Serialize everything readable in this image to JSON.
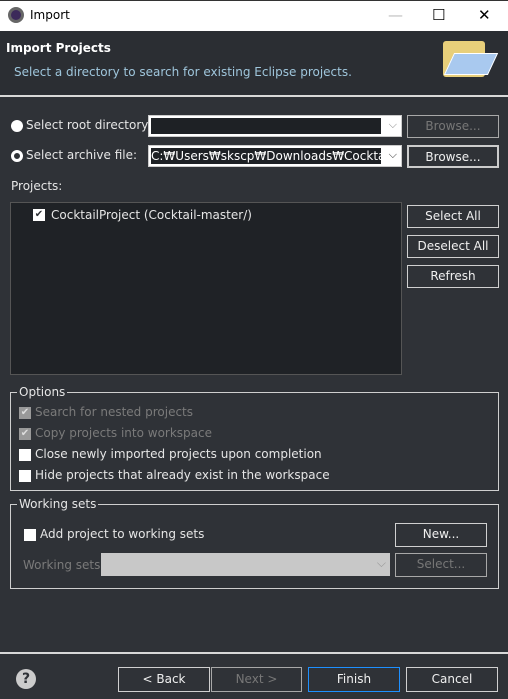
{
  "window": {
    "title": "Import",
    "minimize": "—",
    "maximize": "☐",
    "close": "✕"
  },
  "header": {
    "title": "Import Projects",
    "description": "Select a directory to search for existing Eclipse projects."
  },
  "source": {
    "root_label": "Select root directory:",
    "root_value": "",
    "root_browse": "Browse...",
    "archive_label": "Select archive file:",
    "archive_value": "C:₩Users₩skscp₩Downloads₩Cocktail-master.zip",
    "archive_browse": "Browse...",
    "selected": "archive"
  },
  "projects": {
    "label": "Projects:",
    "items": [
      {
        "label": "CocktailProject (Cocktail-master/)",
        "checked": true
      }
    ],
    "select_all": "Select All",
    "deselect_all": "Deselect All",
    "refresh": "Refresh"
  },
  "options": {
    "legend": "Options",
    "items": [
      {
        "label": "Search for nested projects",
        "checked": true,
        "enabled": false
      },
      {
        "label": "Copy projects into workspace",
        "checked": true,
        "enabled": false
      },
      {
        "label": "Close newly imported projects upon completion",
        "checked": false,
        "enabled": true
      },
      {
        "label": "Hide projects that already exist in the workspace",
        "checked": false,
        "enabled": true
      }
    ]
  },
  "working_sets": {
    "legend": "Working sets",
    "add_label": "Add project to working sets",
    "new": "New...",
    "sets_label": "Working sets:",
    "select": "Select..."
  },
  "footer": {
    "help": "?",
    "back": "< Back",
    "next": "Next >",
    "finish": "Finish",
    "cancel": "Cancel"
  },
  "colors": {
    "background": "#2f3237",
    "accent": "#1e90ff",
    "description": "#9fc6dc"
  }
}
